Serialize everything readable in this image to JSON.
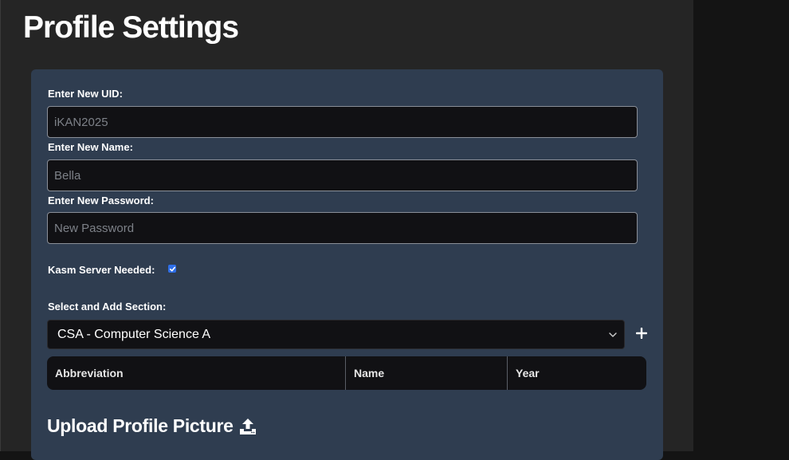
{
  "page": {
    "title": "Profile Settings"
  },
  "form": {
    "uid": {
      "label": "Enter New UID:",
      "placeholder": "iKAN2025"
    },
    "name": {
      "label": "Enter New Name:",
      "placeholder": "Bella"
    },
    "password": {
      "label": "Enter New Password:",
      "placeholder": "New Password"
    },
    "kasm": {
      "label": "Kasm Server Needed:",
      "checked": true
    },
    "section": {
      "label": "Select and Add Section:",
      "selected": "CSA - Computer Science A",
      "add_icon": "plus-icon"
    },
    "table": {
      "columns": [
        "Abbreviation",
        "Name",
        "Year"
      ]
    },
    "upload": {
      "heading": "Upload Profile Picture",
      "icon": "upload-icon"
    }
  },
  "colors": {
    "accent": "#2f6fe8",
    "panel": "#2f3d50",
    "background": "#252525"
  }
}
